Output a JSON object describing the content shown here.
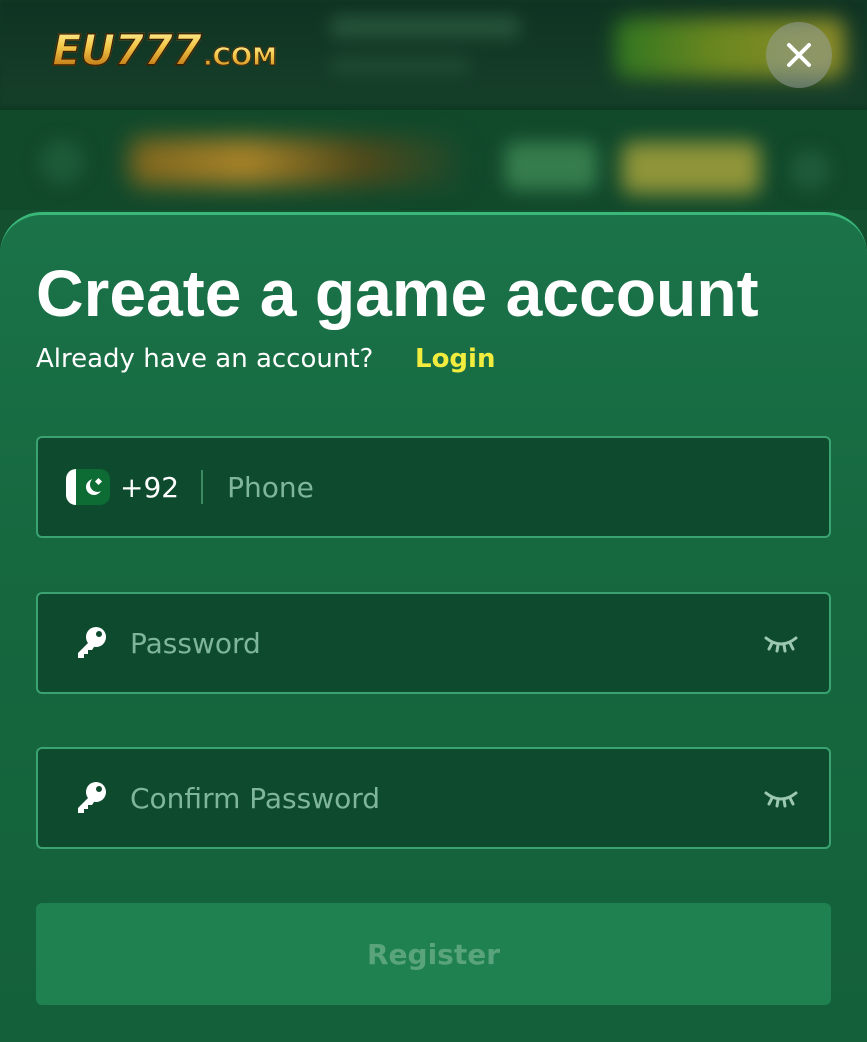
{
  "brand": {
    "name": "EU777",
    "suffix": ".COM"
  },
  "modal": {
    "title": "Create a game account",
    "subtitle": "Already have an account?",
    "login_link": "Login",
    "phone": {
      "country_code": "+92",
      "placeholder": "Phone",
      "flag": "pakistan-flag-icon"
    },
    "password": {
      "placeholder": "Password",
      "icon": "key-icon",
      "toggle_icon": "eye-closed-icon"
    },
    "confirm_password": {
      "placeholder": "Confirm Password",
      "icon": "key-icon",
      "toggle_icon": "eye-closed-icon"
    },
    "register_label": "Register"
  },
  "colors": {
    "sheet": "#1b7349",
    "field_bg": "#0d4a2e",
    "field_border": "#3aa371",
    "login_link": "#f1ec3e",
    "register_bg": "#1f8050",
    "register_text": "#5aa47b"
  }
}
